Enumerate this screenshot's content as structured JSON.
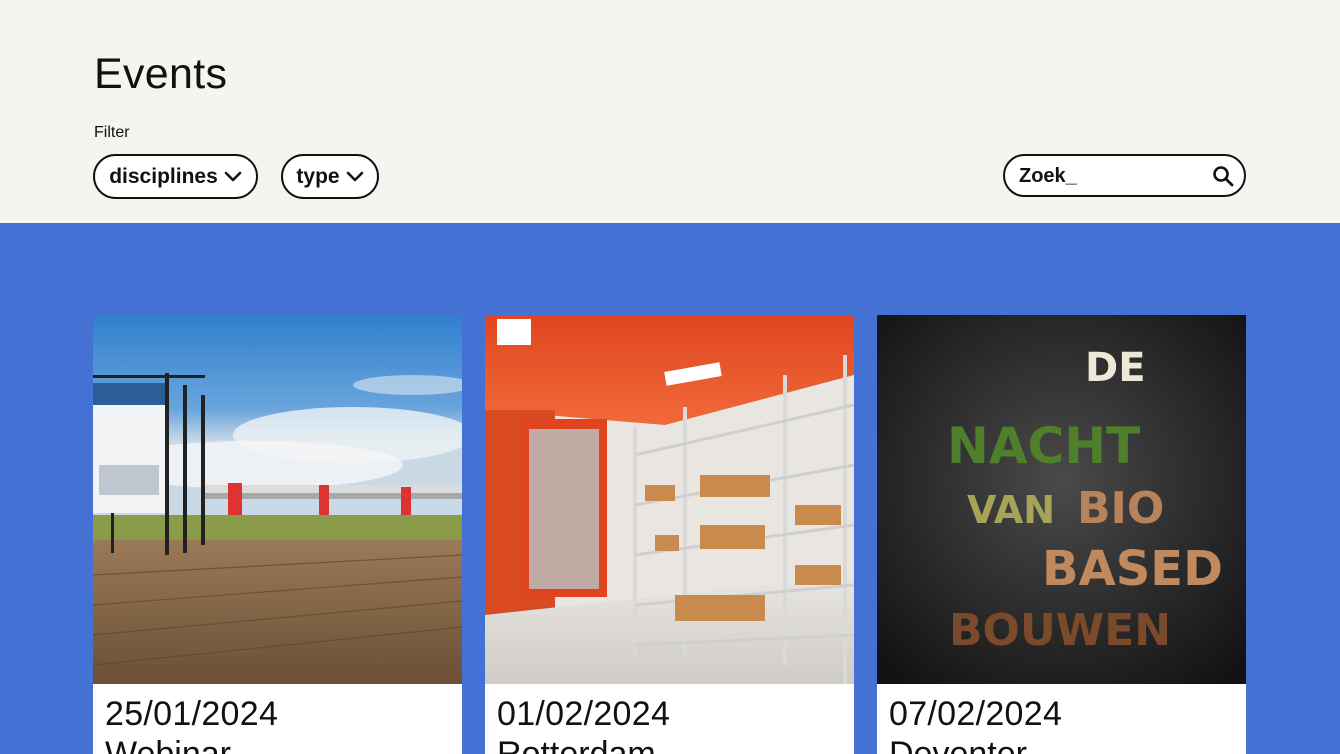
{
  "header": {
    "title": "Events",
    "filter_label": "Filter",
    "filters": [
      {
        "label": "disciplines"
      },
      {
        "label": "type"
      }
    ],
    "search": {
      "placeholder": "Zoek_"
    }
  },
  "colors": {
    "background": "#f6f4ef",
    "main_blue": "#4472d4",
    "text": "#111111"
  },
  "cards": [
    {
      "date": "25/01/2024",
      "title": "Webinar",
      "image": "field-bridge-billboard"
    },
    {
      "date": "01/02/2024",
      "title": "Rotterdam",
      "image": "orange-archive-shelves"
    },
    {
      "date": "07/02/2024",
      "title": "Deventer",
      "image": "nacht-van-biobased-bouwen-poster"
    }
  ],
  "poster_lettering": [
    "DE",
    "NACHT",
    "VAN",
    "BIO",
    "BASED",
    "BOUWEN"
  ]
}
